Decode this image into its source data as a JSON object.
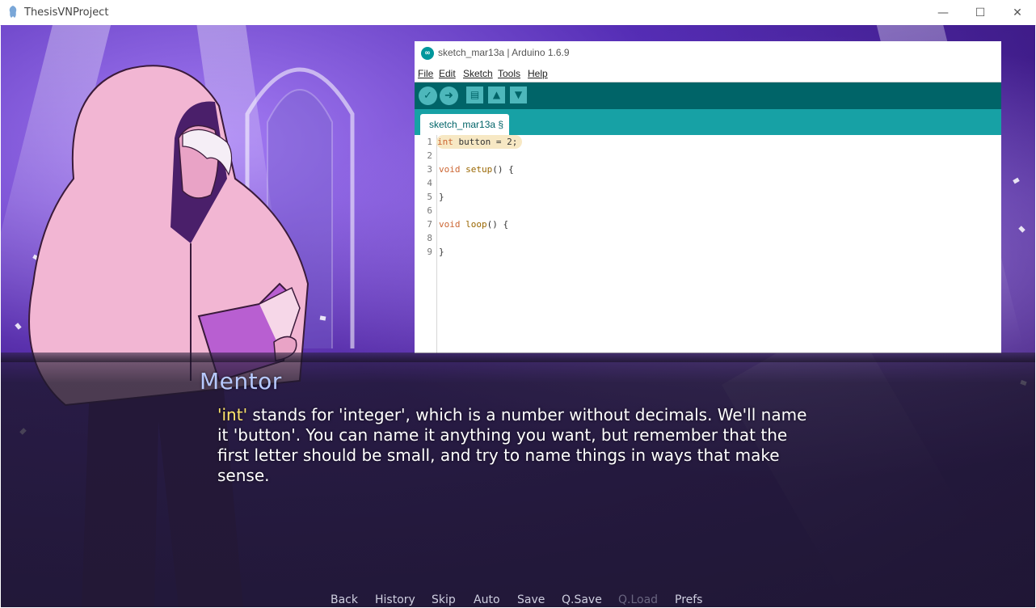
{
  "window": {
    "title": "ThesisVNProject",
    "minimize": "—",
    "maximize": "☐",
    "close": "✕"
  },
  "arduino": {
    "title": "sketch_mar13a | Arduino 1.6.9",
    "logo": "∞",
    "menu": [
      "File",
      "Edit",
      "Sketch",
      "Tools",
      "Help"
    ],
    "toolbar_icons": [
      "verify-icon",
      "upload-icon",
      "new-icon",
      "open-icon",
      "save-icon"
    ],
    "tab_label": "sketch_mar13a §",
    "code_lines": [
      {
        "n": "1",
        "text": "int button = 2;"
      },
      {
        "n": "2",
        "text": ""
      },
      {
        "n": "3",
        "text": "void setup() {"
      },
      {
        "n": "4",
        "text": ""
      },
      {
        "n": "5",
        "text": "}"
      },
      {
        "n": "6",
        "text": ""
      },
      {
        "n": "7",
        "text": "void loop() {"
      },
      {
        "n": "8",
        "text": ""
      },
      {
        "n": "9",
        "text": "}"
      }
    ]
  },
  "dialogue": {
    "speaker": "Mentor",
    "highlight": "'int'",
    "text": " stands for 'integer', which is a number without decimals. We'll name it 'button'. You can name it anything you want, but remember that the first letter should be small, and try to name things in ways that make sense."
  },
  "quick_menu": {
    "back": "Back",
    "history": "History",
    "skip": "Skip",
    "auto": "Auto",
    "save": "Save",
    "qsave": "Q.Save",
    "qload": "Q.Load",
    "prefs": "Prefs"
  },
  "colors": {
    "arduino_toolbar": "#006468",
    "arduino_tabs": "#17a1a5",
    "speaker_name": "#b7c9ff",
    "highlight_word": "#ffe66b"
  }
}
